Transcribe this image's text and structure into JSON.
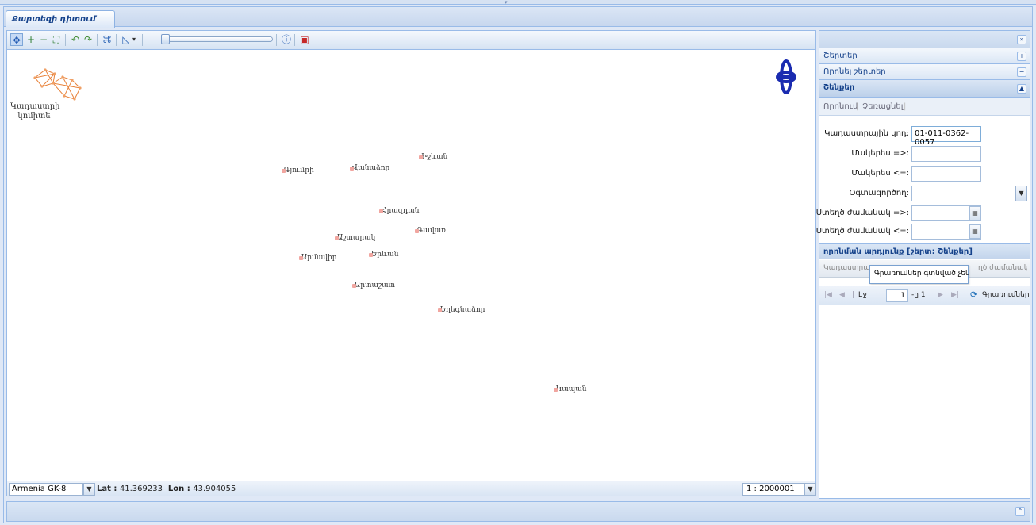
{
  "tab": {
    "label": "Քարտեզի դիտում"
  },
  "map": {
    "logo_text": "Կադաստրի կոմիտե",
    "cities": [
      {
        "name": "Գյումրի"
      },
      {
        "name": "Վանաձոր"
      },
      {
        "name": "Իջևան"
      },
      {
        "name": "Հրազդան"
      },
      {
        "name": "Աշտարակ"
      },
      {
        "name": "Գավառ"
      },
      {
        "name": "Արմավիր"
      },
      {
        "name": "Երևան"
      },
      {
        "name": "Արտաշատ"
      },
      {
        "name": "Եղեգնաձոր"
      },
      {
        "name": "Կապան"
      }
    ],
    "projection": "Armenia GK-8",
    "lat_label": "Lat :",
    "lat_value": "41.369233",
    "lon_label": "Lon :",
    "lon_value": "43.904055",
    "scale": "1 : 2000001"
  },
  "sidebar": {
    "sections": [
      {
        "label": "Շերտեր"
      },
      {
        "label": "Որոնել շերտեր"
      },
      {
        "label": "Շենքեր"
      }
    ],
    "subtabs": [
      "Որոնում",
      "Չեռացնել"
    ],
    "form": {
      "cadastral_code_label": "Կադաստրային կոդ:",
      "cadastral_code_value": "01-011-0362-0057",
      "area_min_label": "Մակերես =>:",
      "area_max_label": "Մակերես <=:",
      "user_label": "Օգտագործող:",
      "created_from_label": "Ստեղծ ժամանակ =>:",
      "created_to_label": "Ստեղծ ժամանակ <=:"
    },
    "results": {
      "title": "որոնման արդյունք [շերտ: Շենքեր]",
      "columns": [
        "Կադաստրա",
        "ղծ ժամանակ"
      ],
      "empty_message": "Գրառումներ գտնված չեն",
      "pager": {
        "page_label": "Էջ",
        "page_value": "1",
        "of_label": "-ը 1",
        "status": "Գրառումներ գտ"
      }
    }
  },
  "colors": {
    "header_blue": "#15428b",
    "border": "#99bbe8",
    "city_marker": "#f1a6a0",
    "compass": "#1a2bb0"
  }
}
